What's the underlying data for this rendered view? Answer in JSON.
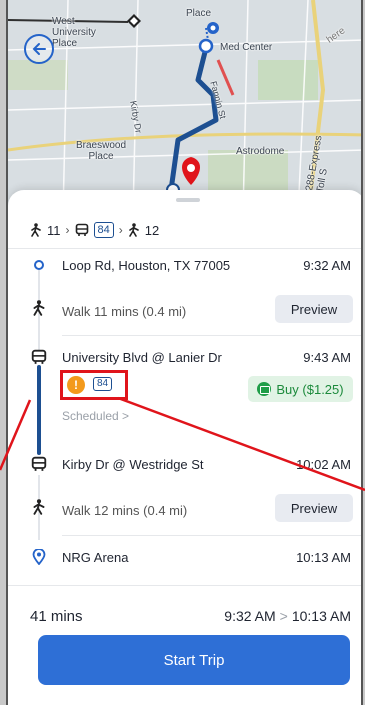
{
  "map": {
    "labels": {
      "west_university": "West\nUniversity\nPlace",
      "place_top": "Place",
      "med_center": "Med Center",
      "braeswood": "Braeswood\nPlace",
      "astrodome": "Astrodome",
      "kirby": "Kirby Dr",
      "fannin": "Fannin St",
      "express": "288-Express Toll S",
      "here": "here"
    }
  },
  "summary": {
    "walk1": "11",
    "bus": "84",
    "walk2": "12"
  },
  "steps": [
    {
      "icon": "origin-icon",
      "text": "Loop Rd, Houston, TX 77005",
      "time": "9:32 AM"
    },
    {
      "icon": "walk-icon",
      "text": "Walk 11 mins (0.4 mi)",
      "action": "Preview"
    },
    {
      "icon": "bus-icon",
      "text": "University Blvd @ Lanier Dr",
      "time": "9:43 AM"
    },
    {
      "icon": "bus-icon",
      "text": "Kirby Dr @ Westridge St",
      "time": "10:02 AM"
    },
    {
      "icon": "walk-icon",
      "text": "Walk 12 mins (0.4 mi)",
      "action": "Preview"
    },
    {
      "icon": "destination-icon",
      "text": "NRG Arena",
      "time": "10:13 AM"
    }
  ],
  "transit": {
    "route": "84",
    "alert": "!",
    "buy_label": "Buy ($1.25)",
    "scheduled": "Scheduled >"
  },
  "footer": {
    "duration": "41 mins",
    "depart": "9:32 AM",
    "arrow": ">",
    "arrive": "10:13 AM",
    "start_label": "Start Trip"
  },
  "colors": {
    "accent": "#2e6fd6",
    "route": "#1d4f91",
    "buy_bg": "#e1f3e5",
    "buy_text": "#1c8a3c",
    "alert": "#f39a1c",
    "annotation": "#e0141b"
  }
}
